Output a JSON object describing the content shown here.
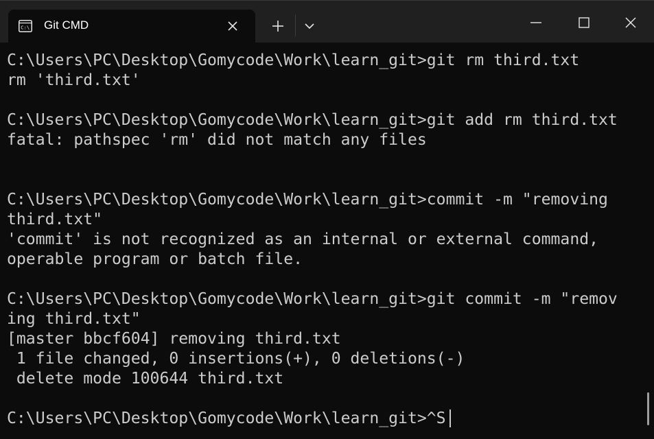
{
  "window": {
    "tab_title": "Git CMD",
    "tab_icon": "cmd-icon",
    "buttons": {
      "new_tab": "plus-icon",
      "dropdown": "chevron-down-icon",
      "minimize": "minimize-icon",
      "maximize": "maximize-icon",
      "close": "close-icon"
    }
  },
  "terminal": {
    "lines": [
      "C:\\Users\\PC\\Desktop\\Gomycode\\Work\\learn_git>git rm third.txt",
      "rm 'third.txt'",
      "",
      "C:\\Users\\PC\\Desktop\\Gomycode\\Work\\learn_git>git add rm third.txt",
      "fatal: pathspec 'rm' did not match any files",
      "",
      "",
      "C:\\Users\\PC\\Desktop\\Gomycode\\Work\\learn_git>commit -m \"removing",
      "third.txt\"",
      "'commit' is not recognized as an internal or external command,",
      "operable program or batch file.",
      "",
      "C:\\Users\\PC\\Desktop\\Gomycode\\Work\\learn_git>git commit -m \"remov",
      "ing third.txt\"",
      "[master bbcf604] removing third.txt",
      " 1 file changed, 0 insertions(+), 0 deletions(-)",
      " delete mode 100644 third.txt",
      "",
      "C:\\Users\\PC\\Desktop\\Gomycode\\Work\\learn_git>^S"
    ]
  },
  "colors": {
    "background": "#0c0c0c",
    "titlebar": "#202020",
    "text": "#cccccc",
    "tab_text": "#ffffff"
  }
}
